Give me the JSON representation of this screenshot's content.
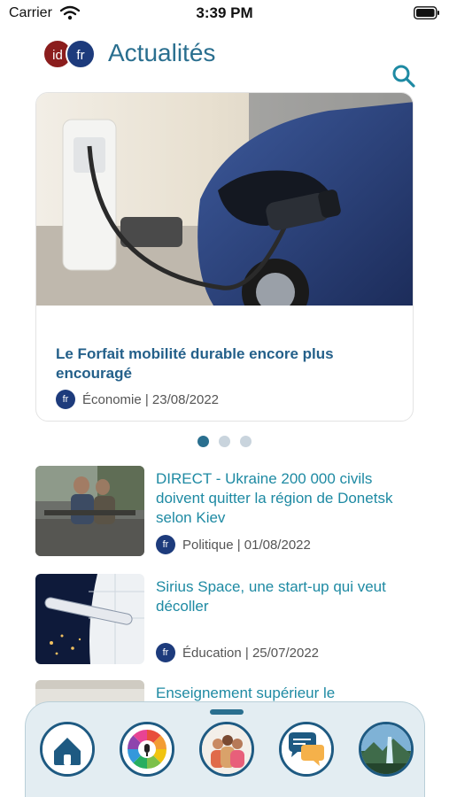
{
  "status": {
    "carrier": "Carrier",
    "time": "3:39 PM"
  },
  "header": {
    "logo_left": "id",
    "logo_right": "fr",
    "title": "Actualités"
  },
  "featured": {
    "title": "Le Forfait mobilité durable encore plus encouragé",
    "badge": "fr",
    "meta": "Économie | 23/08/2022"
  },
  "pagination": {
    "count": 3,
    "active_index": 0
  },
  "articles": [
    {
      "title": "DIRECT - Ukraine   200 000 civils doivent quitter la région de Donetsk selon Kiev",
      "badge": "fr",
      "meta": "Politique | 01/08/2022"
    },
    {
      "title": "Sirius Space, une start-up qui veut décoller",
      "badge": "fr",
      "meta": "Éducation | 25/07/2022"
    },
    {
      "title": "Enseignement supérieur   le"
    }
  ],
  "bottom_nav": {
    "items": [
      {
        "icon": "home-icon"
      },
      {
        "icon": "categories-wheel-icon"
      },
      {
        "icon": "community-icon"
      },
      {
        "icon": "chat-bubble-icon"
      },
      {
        "icon": "landscape-icon"
      }
    ]
  },
  "colors": {
    "accent": "#2a6f8f",
    "link": "#1e8aa3",
    "title_blue": "#24608a",
    "logo_red": "#8b1d1d",
    "logo_blue": "#1d3b7c"
  }
}
